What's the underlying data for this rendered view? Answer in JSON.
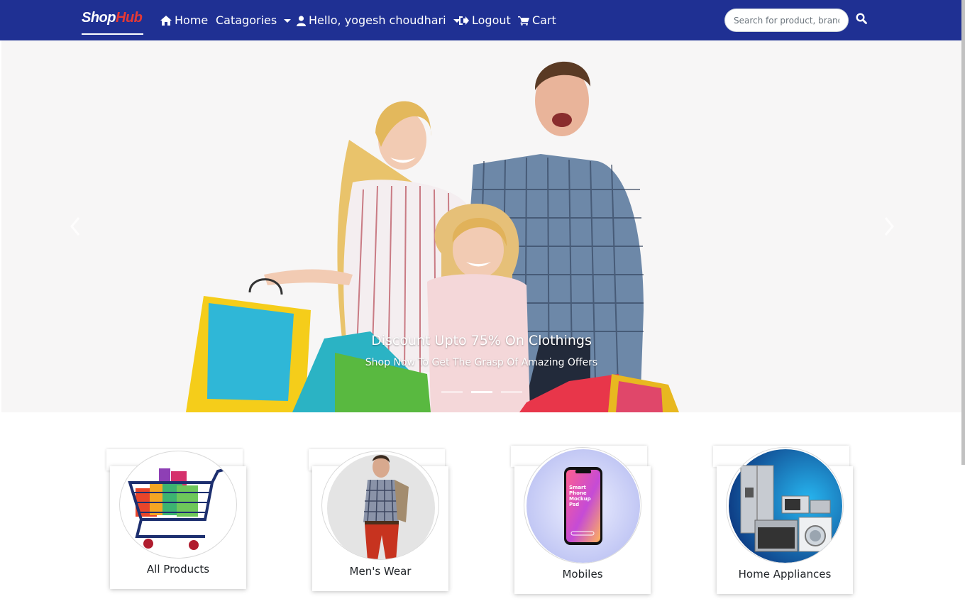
{
  "navbar": {
    "brand_part1": "Shop",
    "brand_part2": "Hub",
    "home_label": "Home",
    "categories_label": "Catagories",
    "user_label": "Hello, yogesh choudhari",
    "logout_label": "Logout",
    "cart_label": "Cart",
    "search_placeholder": "Search for product, brand"
  },
  "carousel": {
    "caption_title": "Discount Upto 75% On Clothings",
    "caption_subtitle": "Shop Now To Get The Grasp Of Amazing Offers",
    "indicator_count": 3,
    "active_indicator": 2
  },
  "categories": [
    {
      "label": "All Products",
      "icon": "shopping-cart-icon"
    },
    {
      "label": "Men's Wear",
      "icon": "man-fashion-icon"
    },
    {
      "label": "Mobiles",
      "icon": "smartphone-icon"
    },
    {
      "label": "Home Appliances",
      "icon": "appliances-icon"
    }
  ],
  "colors": {
    "navbar_bg": "#1f3093",
    "brand_accent": "#e53935",
    "text_dark": "#212529"
  }
}
